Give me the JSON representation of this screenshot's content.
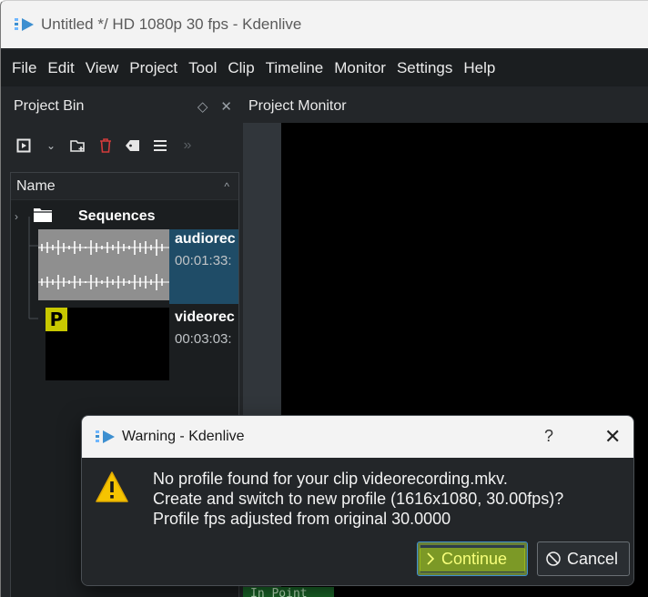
{
  "window": {
    "title": "Untitled */ HD 1080p 30 fps - Kdenlive"
  },
  "menu": [
    "File",
    "Edit",
    "View",
    "Project",
    "Tool",
    "Clip",
    "Timeline",
    "Monitor",
    "Settings",
    "Help"
  ],
  "project_bin": {
    "title": "Project Bin",
    "tree_header": "Name",
    "folder": "Sequences",
    "clips": [
      {
        "name": "audiorec",
        "duration": "00:01:33:",
        "selected": true
      },
      {
        "name": "videorec",
        "duration": "00:03:03:",
        "selected": false
      }
    ]
  },
  "monitor": {
    "title": "Project Monitor",
    "in_point": "In Point"
  },
  "dialog": {
    "title": "Warning - Kdenlive",
    "help": "?",
    "message_lines": [
      "No profile found for your clip videorecording.mkv.",
      "Create and switch to new profile (1616x1080, 30.00fps)?",
      "Profile fps adjusted from original 30.0000"
    ],
    "continue_label": "Continue",
    "cancel_label": "Cancel"
  },
  "colors": {
    "accent_blue": "#3d8fd0",
    "highlight_yellow": "#d6ff14",
    "warning_yellow": "#f5c400",
    "proxy_badge": "#c8c800"
  }
}
